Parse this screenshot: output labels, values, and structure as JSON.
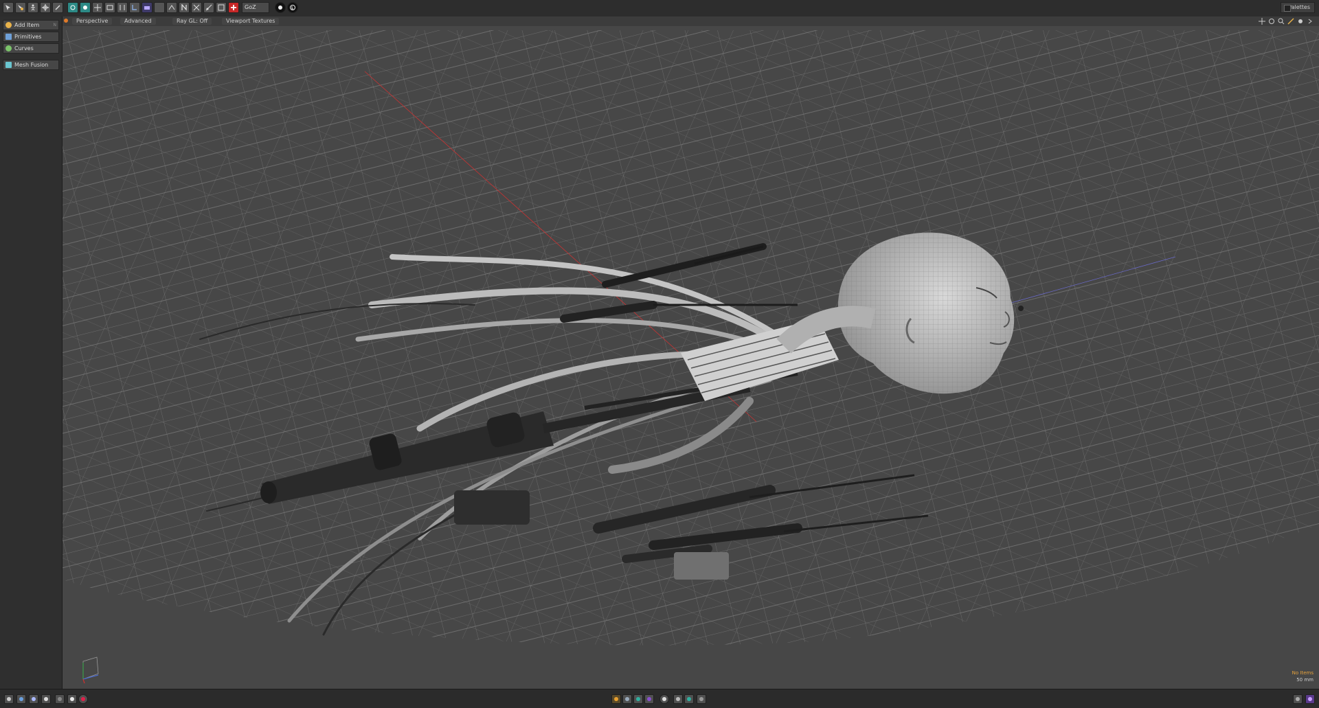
{
  "toolbar": {
    "goz_label": "GoZ",
    "palettes_label": "Palettes",
    "tool_icons": [
      "select-arrow-icon",
      "paint-select-icon",
      "figure-icon",
      "move-icon",
      "transform-icon",
      "grid-icon",
      "snap-icon",
      "symmetry-icon",
      "workplane-icon",
      "border-icon",
      "uv-icon",
      "camera-icon",
      "toggle-icon",
      "mesh-icon",
      "flip-icon",
      "mirror-icon",
      "edge-icon",
      "scale-icon",
      "add-icon",
      "goz-icon",
      "unity-icon",
      "unreal-icon"
    ]
  },
  "left_panel": {
    "items": [
      {
        "label": "Add Item",
        "hotkey": "N",
        "icon": "add-icon",
        "color": "#e8b24a"
      },
      {
        "label": "Primitives",
        "hotkey": "",
        "icon": "cube-icon",
        "color": "#6ea0d8"
      },
      {
        "label": "Curves",
        "hotkey": "",
        "icon": "curve-icon",
        "color": "#7cc46a"
      },
      {
        "label": "Mesh Fusion",
        "hotkey": "",
        "icon": "fusion-icon",
        "color": "#6ac6d0"
      }
    ]
  },
  "viewport": {
    "tabs": [
      "Perspective",
      "Advanced",
      "Ray GL: Off",
      "Viewport Textures"
    ],
    "no_items": "No Items",
    "focal_length": "50 mm",
    "nav_icons": [
      "pan-icon",
      "orbit-icon",
      "zoom-icon",
      "fit-icon",
      "settings-icon",
      "expand-icon"
    ]
  },
  "bottom_bar": {
    "icons": [
      "link-icon",
      "shield-icon",
      "sphere-icon",
      "material-icon",
      "brush-icon",
      "circle-icon",
      "record-icon",
      "shader-icon",
      "layer-icon",
      "texture-icon",
      "render-icon",
      "timer-icon",
      "curve-tool-icon",
      "spline-icon",
      "gear-icon",
      "frame-icon",
      "power-icon"
    ],
    "accent_colors": {
      "record": "#e0204a",
      "shader": "#e8a030",
      "purple": "#8a50d0",
      "teal": "#30b0a0"
    }
  }
}
